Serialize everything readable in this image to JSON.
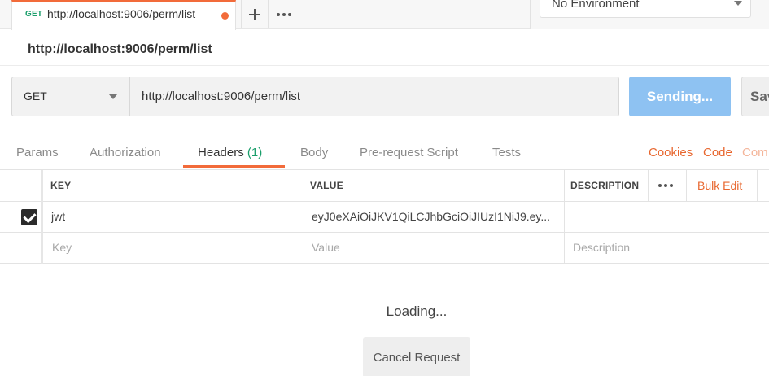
{
  "tab": {
    "method": "GET",
    "title": "http://localhost:9006/perm/list"
  },
  "environment": {
    "selected": "No Environment"
  },
  "request": {
    "name": "http://localhost:9006/perm/list",
    "method": "GET",
    "url": "http://localhost:9006/perm/list",
    "send_label": "Sending...",
    "save_label": "Save"
  },
  "req_tabs": {
    "params": "Params",
    "authorization": "Authorization",
    "headers": "Headers",
    "headers_count": "(1)",
    "body": "Body",
    "prerequest": "Pre-request Script",
    "tests": "Tests",
    "cookies": "Cookies",
    "code": "Code",
    "comments": "Com"
  },
  "headers_table": {
    "columns": {
      "key": "KEY",
      "value": "VALUE",
      "description": "DESCRIPTION"
    },
    "bulk_edit": "Bulk Edit",
    "rows": [
      {
        "key": "jwt",
        "value": "eyJ0eXAiOiJKV1QiLCJhbGciOiJIUzI1NiJ9.ey...",
        "description": "",
        "checked": true
      }
    ],
    "placeholders": {
      "key": "Key",
      "value": "Value",
      "description": "Description"
    }
  },
  "status": {
    "loading": "Loading...",
    "cancel_label": "Cancel Request"
  },
  "colors": {
    "accent": "#f26b3a",
    "method_get": "#1a9e6b",
    "send_button": "#8ec2f2",
    "link": "#e8672f"
  }
}
